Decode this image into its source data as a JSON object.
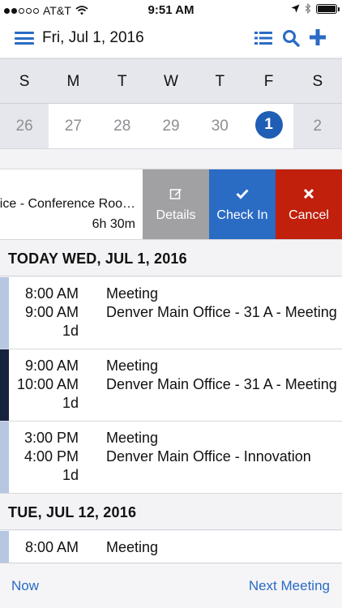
{
  "status_bar": {
    "carrier": "AT&T",
    "time": "9:51 AM",
    "signal_strength": 2,
    "battery_level": 1.0
  },
  "nav": {
    "title": "Fri, Jul 1, 2016",
    "menu_icon": "hamburger-icon",
    "list_icon": "list-icon",
    "search_icon": "search-icon",
    "add_icon": "plus-icon"
  },
  "week": {
    "headers": [
      "S",
      "M",
      "T",
      "W",
      "T",
      "F",
      "S"
    ],
    "days": [
      "26",
      "27",
      "28",
      "29",
      "30",
      "1",
      "2"
    ],
    "selected_index": 5
  },
  "swipe_row": {
    "location": "Denver Main Office - Conference Roo…",
    "duration": "6h 30m",
    "actions": {
      "details": "Details",
      "check_in": "Check In",
      "cancel": "Cancel"
    }
  },
  "sections": [
    {
      "title": "TODAY WED, JUL 1, 2016",
      "events": [
        {
          "start": "8:00 AM",
          "end": "9:00 AM",
          "duration": "1d",
          "title": "Meeting",
          "location": "Denver Main Office - 31 A - Meeting",
          "color": "#b6c7e2"
        },
        {
          "start": "9:00 AM",
          "end": "10:00 AM",
          "duration": "1d",
          "title": "Meeting",
          "location": "Denver Main Office - 31 A - Meeting",
          "color": "#16233f"
        },
        {
          "start": "3:00 PM",
          "end": "4:00 PM",
          "duration": "1d",
          "title": "Meeting",
          "location": "Denver Main Office - Innovation",
          "color": "#b6c7e2"
        }
      ]
    },
    {
      "title": "TUE, JUL 12, 2016",
      "events": [
        {
          "start": "8:00 AM",
          "end": "",
          "duration": "",
          "title": "Meeting",
          "location": "",
          "color": "#b6c7e2"
        }
      ]
    }
  ],
  "bottom_bar": {
    "now": "Now",
    "next_meeting": "Next Meeting"
  }
}
